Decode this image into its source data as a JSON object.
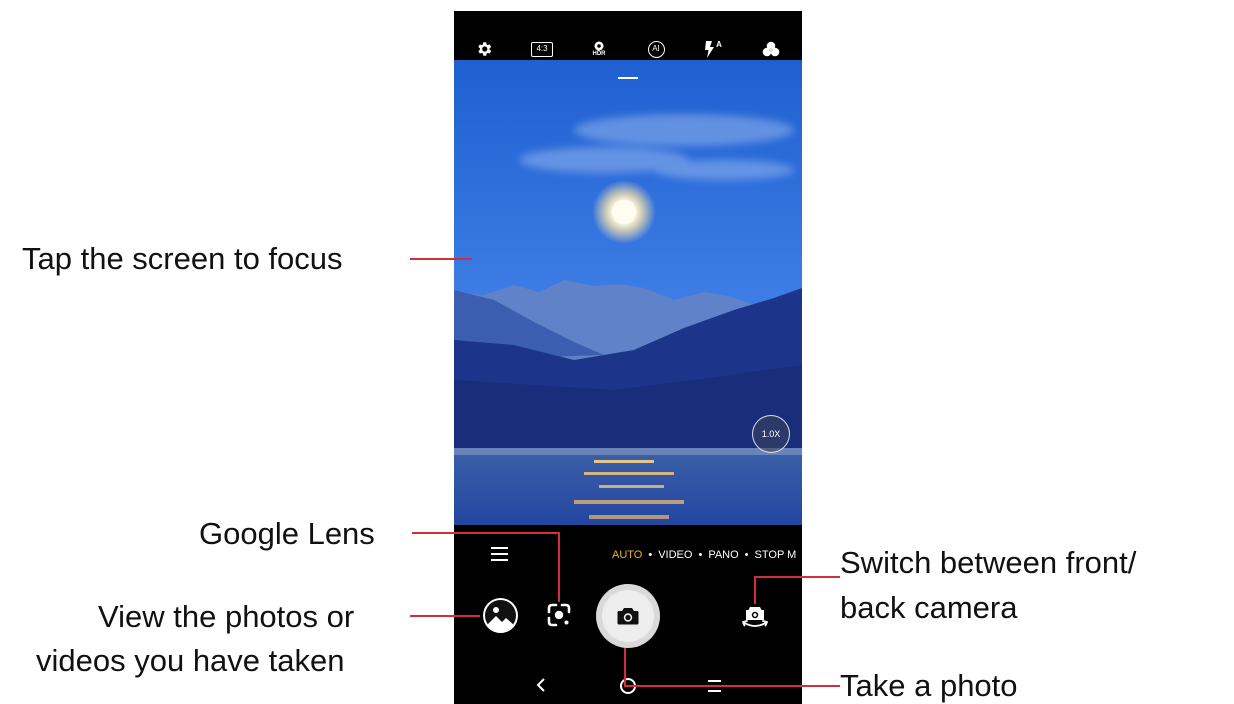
{
  "top_bar": {
    "icons": [
      "gear-icon",
      "aspect-ratio-icon",
      "hdr-icon",
      "ai-icon",
      "flash-auto-icon",
      "filters-icon"
    ],
    "aspect_ratio": "4:3",
    "hdr_label": "HDR",
    "ai_label": "AI",
    "flash_label": "A"
  },
  "viewfinder": {
    "zoom_label": "1.0X"
  },
  "modes": {
    "items": [
      "AUTO",
      "VIDEO",
      "PANO",
      "STOP M"
    ],
    "active": "AUTO"
  },
  "colors": {
    "accent": "#f0b429",
    "callout_line": "#d0303c"
  },
  "annotations": {
    "focus": "Tap the screen to focus",
    "lens": "Google Lens",
    "gallery_line1": "View the photos or",
    "gallery_line2": "videos you have taken",
    "switch_line1": "Switch between front/",
    "switch_line2": "back camera",
    "shutter": "Take a photo"
  }
}
